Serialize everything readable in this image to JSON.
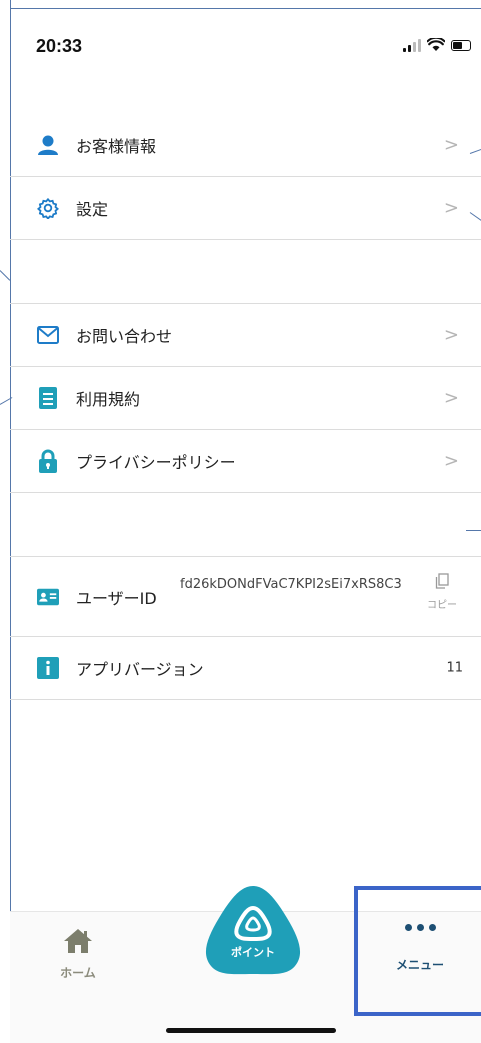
{
  "status_bar": {
    "time": "20:33"
  },
  "colors": {
    "accent": "#1f9fb8",
    "icon_blue": "#1e7cc8",
    "home_tab": "#7c7e6c",
    "menu_tab": "#1d4f73",
    "highlight": "#3b64c8"
  },
  "menu_group_1": [
    {
      "label": "お客様情報",
      "icon": "person-icon",
      "chevron": ">"
    },
    {
      "label": "設定",
      "icon": "gear-icon",
      "chevron": ">"
    }
  ],
  "menu_group_2": [
    {
      "label": "お問い合わせ",
      "icon": "mail-icon",
      "chevron": ">"
    },
    {
      "label": "利用規約",
      "icon": "document-icon",
      "chevron": ">"
    },
    {
      "label": "プライバシーポリシー",
      "icon": "lock-icon",
      "chevron": ">"
    }
  ],
  "user_id": {
    "label": "ユーザーID",
    "value": "fd26kDONdFVaC7KPI2sEi7xRS8C3",
    "copy_label": "コピー"
  },
  "app_version": {
    "label": "アプリバージョン",
    "value": "11"
  },
  "tabbar": {
    "home": {
      "label": "ホーム",
      "icon": "home-icon"
    },
    "point": {
      "label": "ポイント",
      "icon": "point-logo-icon"
    },
    "menu": {
      "label": "メニュー",
      "icon": "more-dots-icon",
      "selected": true
    }
  }
}
